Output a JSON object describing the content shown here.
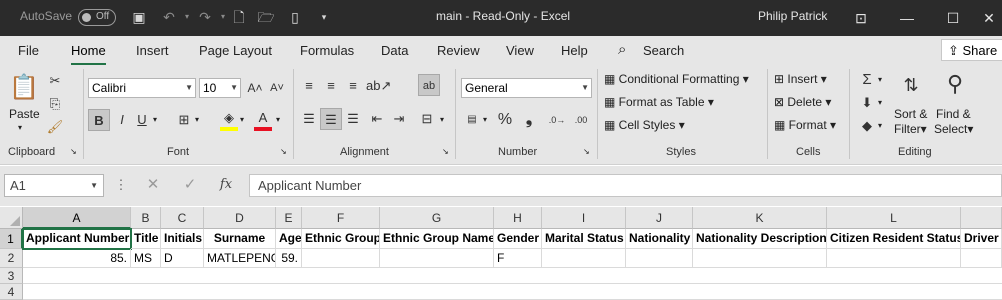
{
  "titlebar": {
    "autosave_label": "AutoSave",
    "autosave_state": "Off",
    "title": "main  -  Read-Only  -  Excel",
    "user": "Philip Patrick",
    "bg_color": "#2b2b2b"
  },
  "tabs": [
    {
      "label": "File"
    },
    {
      "label": "Home"
    },
    {
      "label": "Insert"
    },
    {
      "label": "Page Layout"
    },
    {
      "label": "Formulas"
    },
    {
      "label": "Data"
    },
    {
      "label": "Review"
    },
    {
      "label": "View"
    },
    {
      "label": "Help"
    }
  ],
  "search_label": "Search",
  "share_label": "Share",
  "ribbon": {
    "clipboard": {
      "paste": "Paste",
      "group": "Clipboard"
    },
    "font": {
      "name": "Calibri",
      "size": "10",
      "group": "Font",
      "bold": "B",
      "italic": "I",
      "underline": "U",
      "font_color": "#e81123",
      "highlight_color": "#ffff00"
    },
    "alignment": {
      "group": "Alignment"
    },
    "number": {
      "format": "General",
      "group": "Number",
      "percent": "%"
    },
    "styles": {
      "conditional": "Conditional Formatting",
      "format_table": "Format as Table",
      "cell_styles": "Cell Styles",
      "group": "Styles"
    },
    "cells": {
      "insert": "Insert",
      "delete": "Delete",
      "format": "Format",
      "group": "Cells"
    },
    "editing": {
      "sort": "Sort &",
      "filter": "Filter",
      "find": "Find &",
      "select": "Select",
      "group": "Editing"
    }
  },
  "formula_bar": {
    "name_box": "A1",
    "content": "Applicant Number"
  },
  "sheet": {
    "columns": [
      "A",
      "B",
      "C",
      "D",
      "E",
      "F",
      "G",
      "H",
      "I",
      "J",
      "K",
      "L"
    ],
    "rows": [
      "1",
      "2",
      "3",
      "4"
    ],
    "header_row": [
      "Applicant Number",
      "Title",
      "Initials",
      "Surname",
      "Age",
      "Ethnic Group",
      "Ethnic Group Name",
      "Gender",
      "Marital Status",
      "Nationality",
      "Nationality Description",
      "Citizen Resident Status",
      "Driver"
    ],
    "data_row": [
      "85.",
      "MS",
      "D",
      "MATLEPENG",
      "59.",
      "",
      "",
      "F",
      "",
      "",
      "",
      "",
      ""
    ]
  },
  "accent_color": "#217346"
}
